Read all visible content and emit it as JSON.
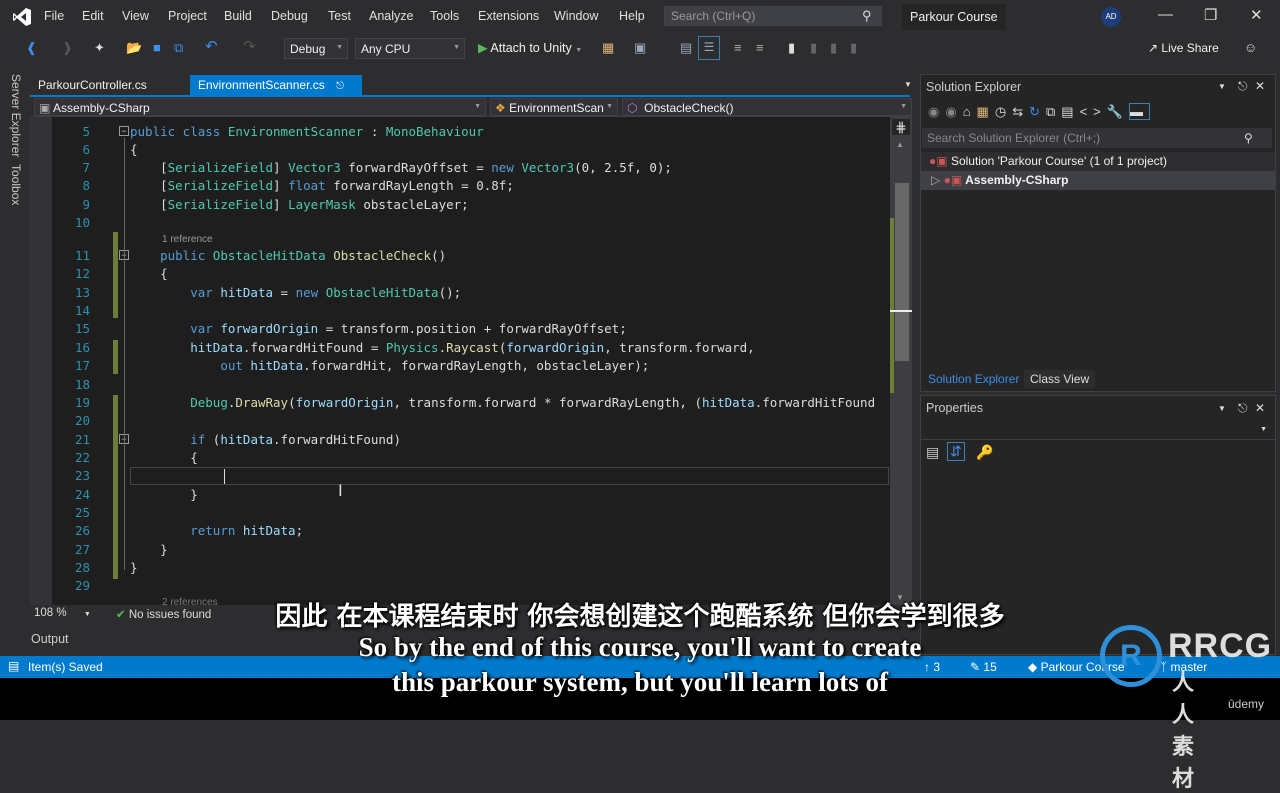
{
  "menu": [
    "File",
    "Edit",
    "View",
    "Project",
    "Build",
    "Debug",
    "Test",
    "Analyze",
    "Tools",
    "Extensions",
    "Window",
    "Help"
  ],
  "search": {
    "placeholder": "Search (Ctrl+Q)"
  },
  "project_title": "Parkour Course",
  "user_initials": "AD",
  "toolbar": {
    "configuration": "Debug",
    "platform": "Any CPU",
    "attach_label": "Attach to Unity",
    "live_share": "Live Share"
  },
  "side_tabs": [
    "Server Explorer",
    "Toolbox"
  ],
  "doc_tabs": [
    {
      "label": "ParkourController.cs",
      "active": false
    },
    {
      "label": "EnvironmentScanner.cs",
      "active": true
    }
  ],
  "navbar": {
    "project": "Assembly-CSharp",
    "class": "EnvironmentScan",
    "member": "ObstacleCheck()"
  },
  "code": {
    "lines": [
      {
        "n": "5",
        "html": "<span class='kw'>public class</span> <span class='ty'>EnvironmentScanner</span> : <span class='ty'>MonoBehaviour</span>"
      },
      {
        "n": "6",
        "html": "{"
      },
      {
        "n": "7",
        "html": "    [<span class='ty'>SerializeField</span>] <span class='ty'>Vector3</span> forwardRayOffset = <span class='kw'>new</span> <span class='ty'>Vector3</span>(0, 2.5f, 0);"
      },
      {
        "n": "8",
        "html": "    [<span class='ty'>SerializeField</span>] <span class='kw'>float</span> forwardRayLength = 0.8f;"
      },
      {
        "n": "9",
        "html": "    [<span class='ty'>SerializeField</span>] <span class='ty'>LayerMask</span> obstacleLayer;"
      },
      {
        "n": "10",
        "html": ""
      },
      {
        "n": "11",
        "html": "    <span class='kw'>public</span> <span class='ty'>ObstacleHitData</span> <span class='fn'>ObstacleCheck</span>()"
      },
      {
        "n": "12",
        "html": "    {"
      },
      {
        "n": "13",
        "html": "        <span class='kw'>var</span> <span class='var'>hitData</span> = <span class='kw'>new</span> <span class='ty'>ObstacleHitData</span>();"
      },
      {
        "n": "14",
        "html": ""
      },
      {
        "n": "15",
        "html": "        <span class='kw'>var</span> <span class='var'>forwardOrigin</span> = transform.position + forwardRayOffset;"
      },
      {
        "n": "16",
        "html": "        <span class='var'>hitData</span>.forwardHitFound = <span class='ty'>Physics</span>.<span class='fn'>Raycast</span>(<span class='var'>forwardOrigin</span>, transform.forward,"
      },
      {
        "n": "17",
        "html": "            <span class='kw'>out</span> <span class='var'>hitData</span>.forwardHit, forwardRayLength, obstacleLayer);"
      },
      {
        "n": "18",
        "html": ""
      },
      {
        "n": "19",
        "html": "        <span class='ty'>Debug</span>.<span class='fn'>DrawRay</span>(<span class='var'>forwardOrigin</span>, transform.forward * forwardRayLength, (<span class='var'>hitData</span>.forwardHitFound"
      },
      {
        "n": "20",
        "html": ""
      },
      {
        "n": "21",
        "html": "        <span class='kw'>if</span> (<span class='var'>hitData</span>.forwardHitFound)"
      },
      {
        "n": "22",
        "html": "        {"
      },
      {
        "n": "23",
        "html": ""
      },
      {
        "n": "24",
        "html": "        }"
      },
      {
        "n": "25",
        "html": ""
      },
      {
        "n": "26",
        "html": "        <span class='kw'>return</span> <span class='var'>hitData</span>;"
      },
      {
        "n": "27",
        "html": "    }"
      },
      {
        "n": "28",
        "html": "}"
      },
      {
        "n": "29",
        "html": ""
      }
    ],
    "lens_1": "1 reference",
    "lens_2": "2 references"
  },
  "editor_status": {
    "zoom": "108 %",
    "issues": "No issues found"
  },
  "output_label": "Output",
  "statusbar": {
    "message": "Item(s) Saved",
    "up": "3",
    "edits": "15",
    "repo": "Parkour Course",
    "branch": "master"
  },
  "solution_explorer": {
    "title": "Solution Explorer",
    "search_placeholder": "Search Solution Explorer (Ctrl+;)",
    "items": [
      {
        "label": "Solution 'Parkour Course' (1 of 1 project)"
      },
      {
        "label": "Assembly-CSharp"
      }
    ],
    "tabs": [
      "Solution Explorer",
      "Class View"
    ]
  },
  "properties": {
    "title": "Properties"
  },
  "subtitles": {
    "cn": "因此 在本课程结束时 你会想创建这个跑酷系统 但你会学到很多",
    "en1": "So by the end of this course, you'll want to create",
    "en2": "this parkour system, but you'll learn lots of"
  },
  "watermark": {
    "brand": "RRCG",
    "sub": "人人素材",
    "udemy": "ûdemy"
  },
  "colors": {
    "accent": "#007acc",
    "editor_bg": "#1e1e1e",
    "keyword": "#569cd6",
    "type": "#4ec9b0"
  }
}
